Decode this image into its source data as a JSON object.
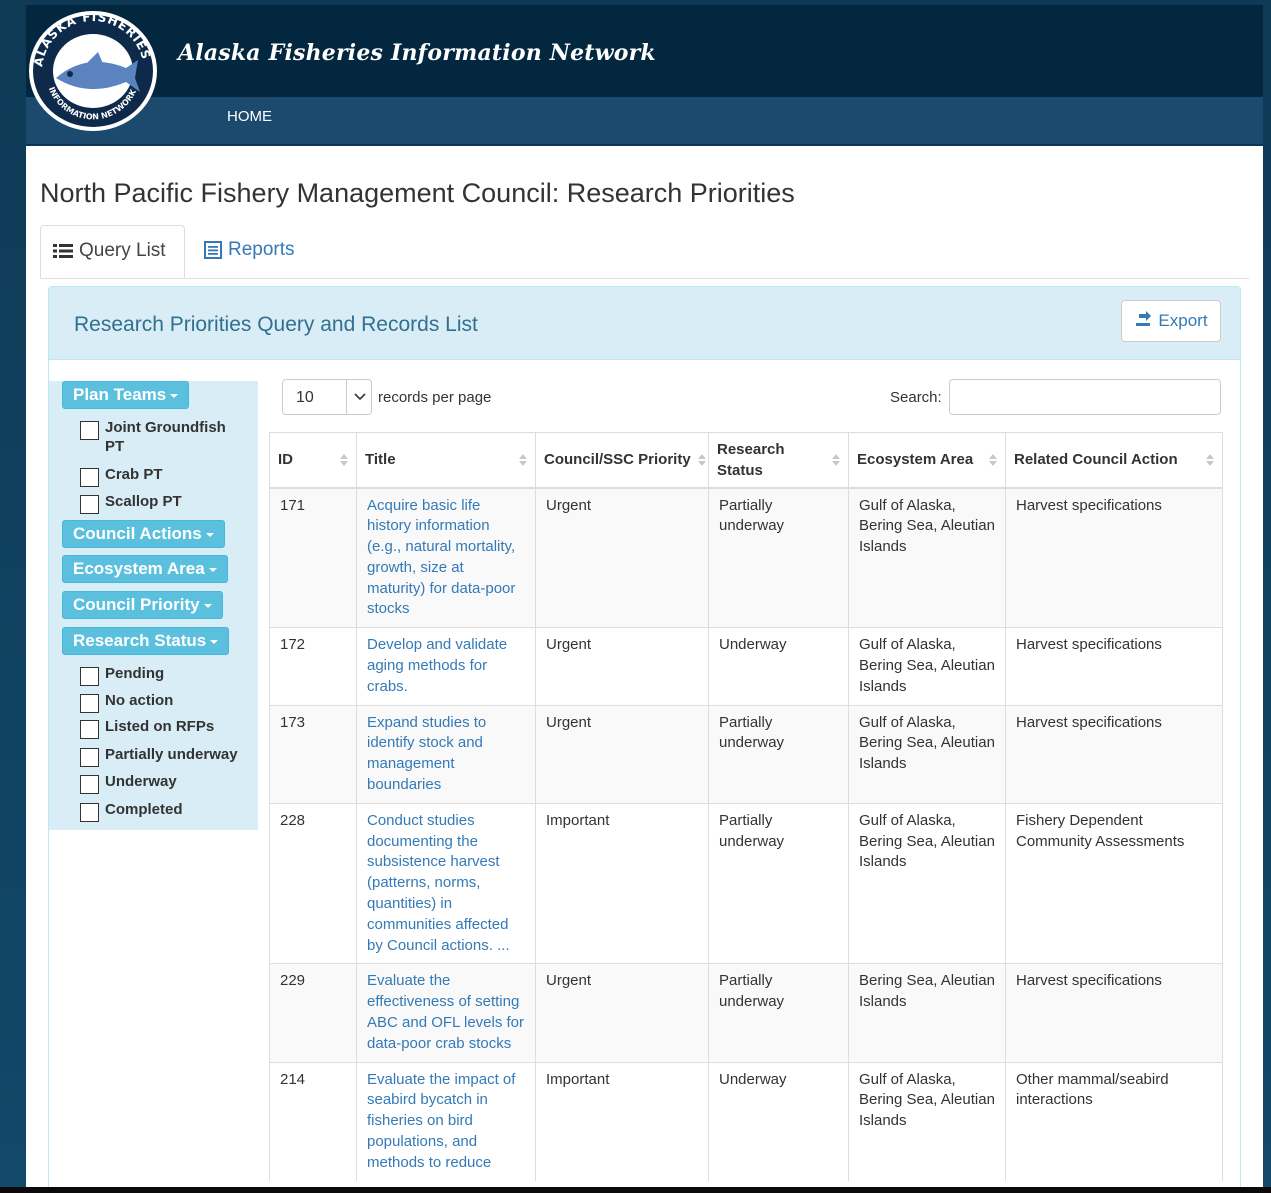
{
  "site": {
    "title": "Alaska Fisheries Information Network",
    "nav_home": "HOME",
    "logo_text_top": "ALASKA FISHERIES",
    "logo_text_bottom": "INFORMATION NETWORK"
  },
  "page": {
    "title": "North Pacific Fishery Management Council: Research Priorities",
    "tabs": [
      {
        "label": "Query List",
        "icon": "list-icon",
        "active": true
      },
      {
        "label": "Reports",
        "icon": "document-icon",
        "active": false
      }
    ]
  },
  "panel": {
    "title": "Research Priorities Query and Records List",
    "export_label": "Export"
  },
  "filters": {
    "plan_teams": {
      "label": "Plan Teams",
      "options": [
        "Joint Groundfish PT",
        "Crab PT",
        "Scallop PT"
      ]
    },
    "council_actions": {
      "label": "Council Actions"
    },
    "ecosystem_area": {
      "label": "Ecosystem Area"
    },
    "council_priority": {
      "label": "Council Priority"
    },
    "research_status": {
      "label": "Research Status",
      "options": [
        "Pending",
        "No action",
        "Listed on RFPs",
        "Partially underway",
        "Underway",
        "Completed"
      ]
    }
  },
  "table_controls": {
    "records_per_page": "10",
    "records_per_page_label": "records per page",
    "search_label": "Search:",
    "search_value": ""
  },
  "table": {
    "columns": [
      "ID",
      "Title",
      "Council/SSC Priority",
      "Research Status",
      "Ecosystem Area",
      "Related Council Action"
    ],
    "rows": [
      {
        "id": "171",
        "title": "Acquire basic life history information (e.g., natural mortality, growth, size at maturity) for data-poor stocks",
        "priority": "Urgent",
        "status": "Partially underway",
        "area": "Gulf of Alaska, Bering Sea, Aleutian Islands",
        "action": "Harvest specifications"
      },
      {
        "id": "172",
        "title": "Develop and validate aging methods for crabs.",
        "priority": "Urgent",
        "status": "Underway",
        "area": "Gulf of Alaska, Bering Sea, Aleutian Islands",
        "action": "Harvest specifications"
      },
      {
        "id": "173",
        "title": "Expand studies to identify stock and management boundaries",
        "priority": "Urgent",
        "status": "Partially underway",
        "area": "Gulf of Alaska, Bering Sea, Aleutian Islands",
        "action": "Harvest specifications"
      },
      {
        "id": "228",
        "title": "Conduct studies documenting the subsistence harvest (patterns, norms, quantities) in communities affected by Council actions. ...",
        "priority": "Important",
        "status": "Partially underway",
        "area": "Gulf of Alaska, Bering Sea, Aleutian Islands",
        "action": "Fishery Dependent Community Assessments"
      },
      {
        "id": "229",
        "title": "Evaluate the effectiveness of setting ABC and OFL levels for data-poor crab stocks",
        "priority": "Urgent",
        "status": "Partially underway",
        "area": "Bering Sea, Aleutian Islands",
        "action": "Harvest specifications"
      },
      {
        "id": "214",
        "title": "Evaluate the impact of seabird bycatch in fisheries on bird populations, and methods to reduce",
        "priority": "Important",
        "status": "Underway",
        "area": "Gulf of Alaska, Bering Sea, Aleutian Islands",
        "action": "Other mammal/seabird interactions"
      }
    ]
  }
}
